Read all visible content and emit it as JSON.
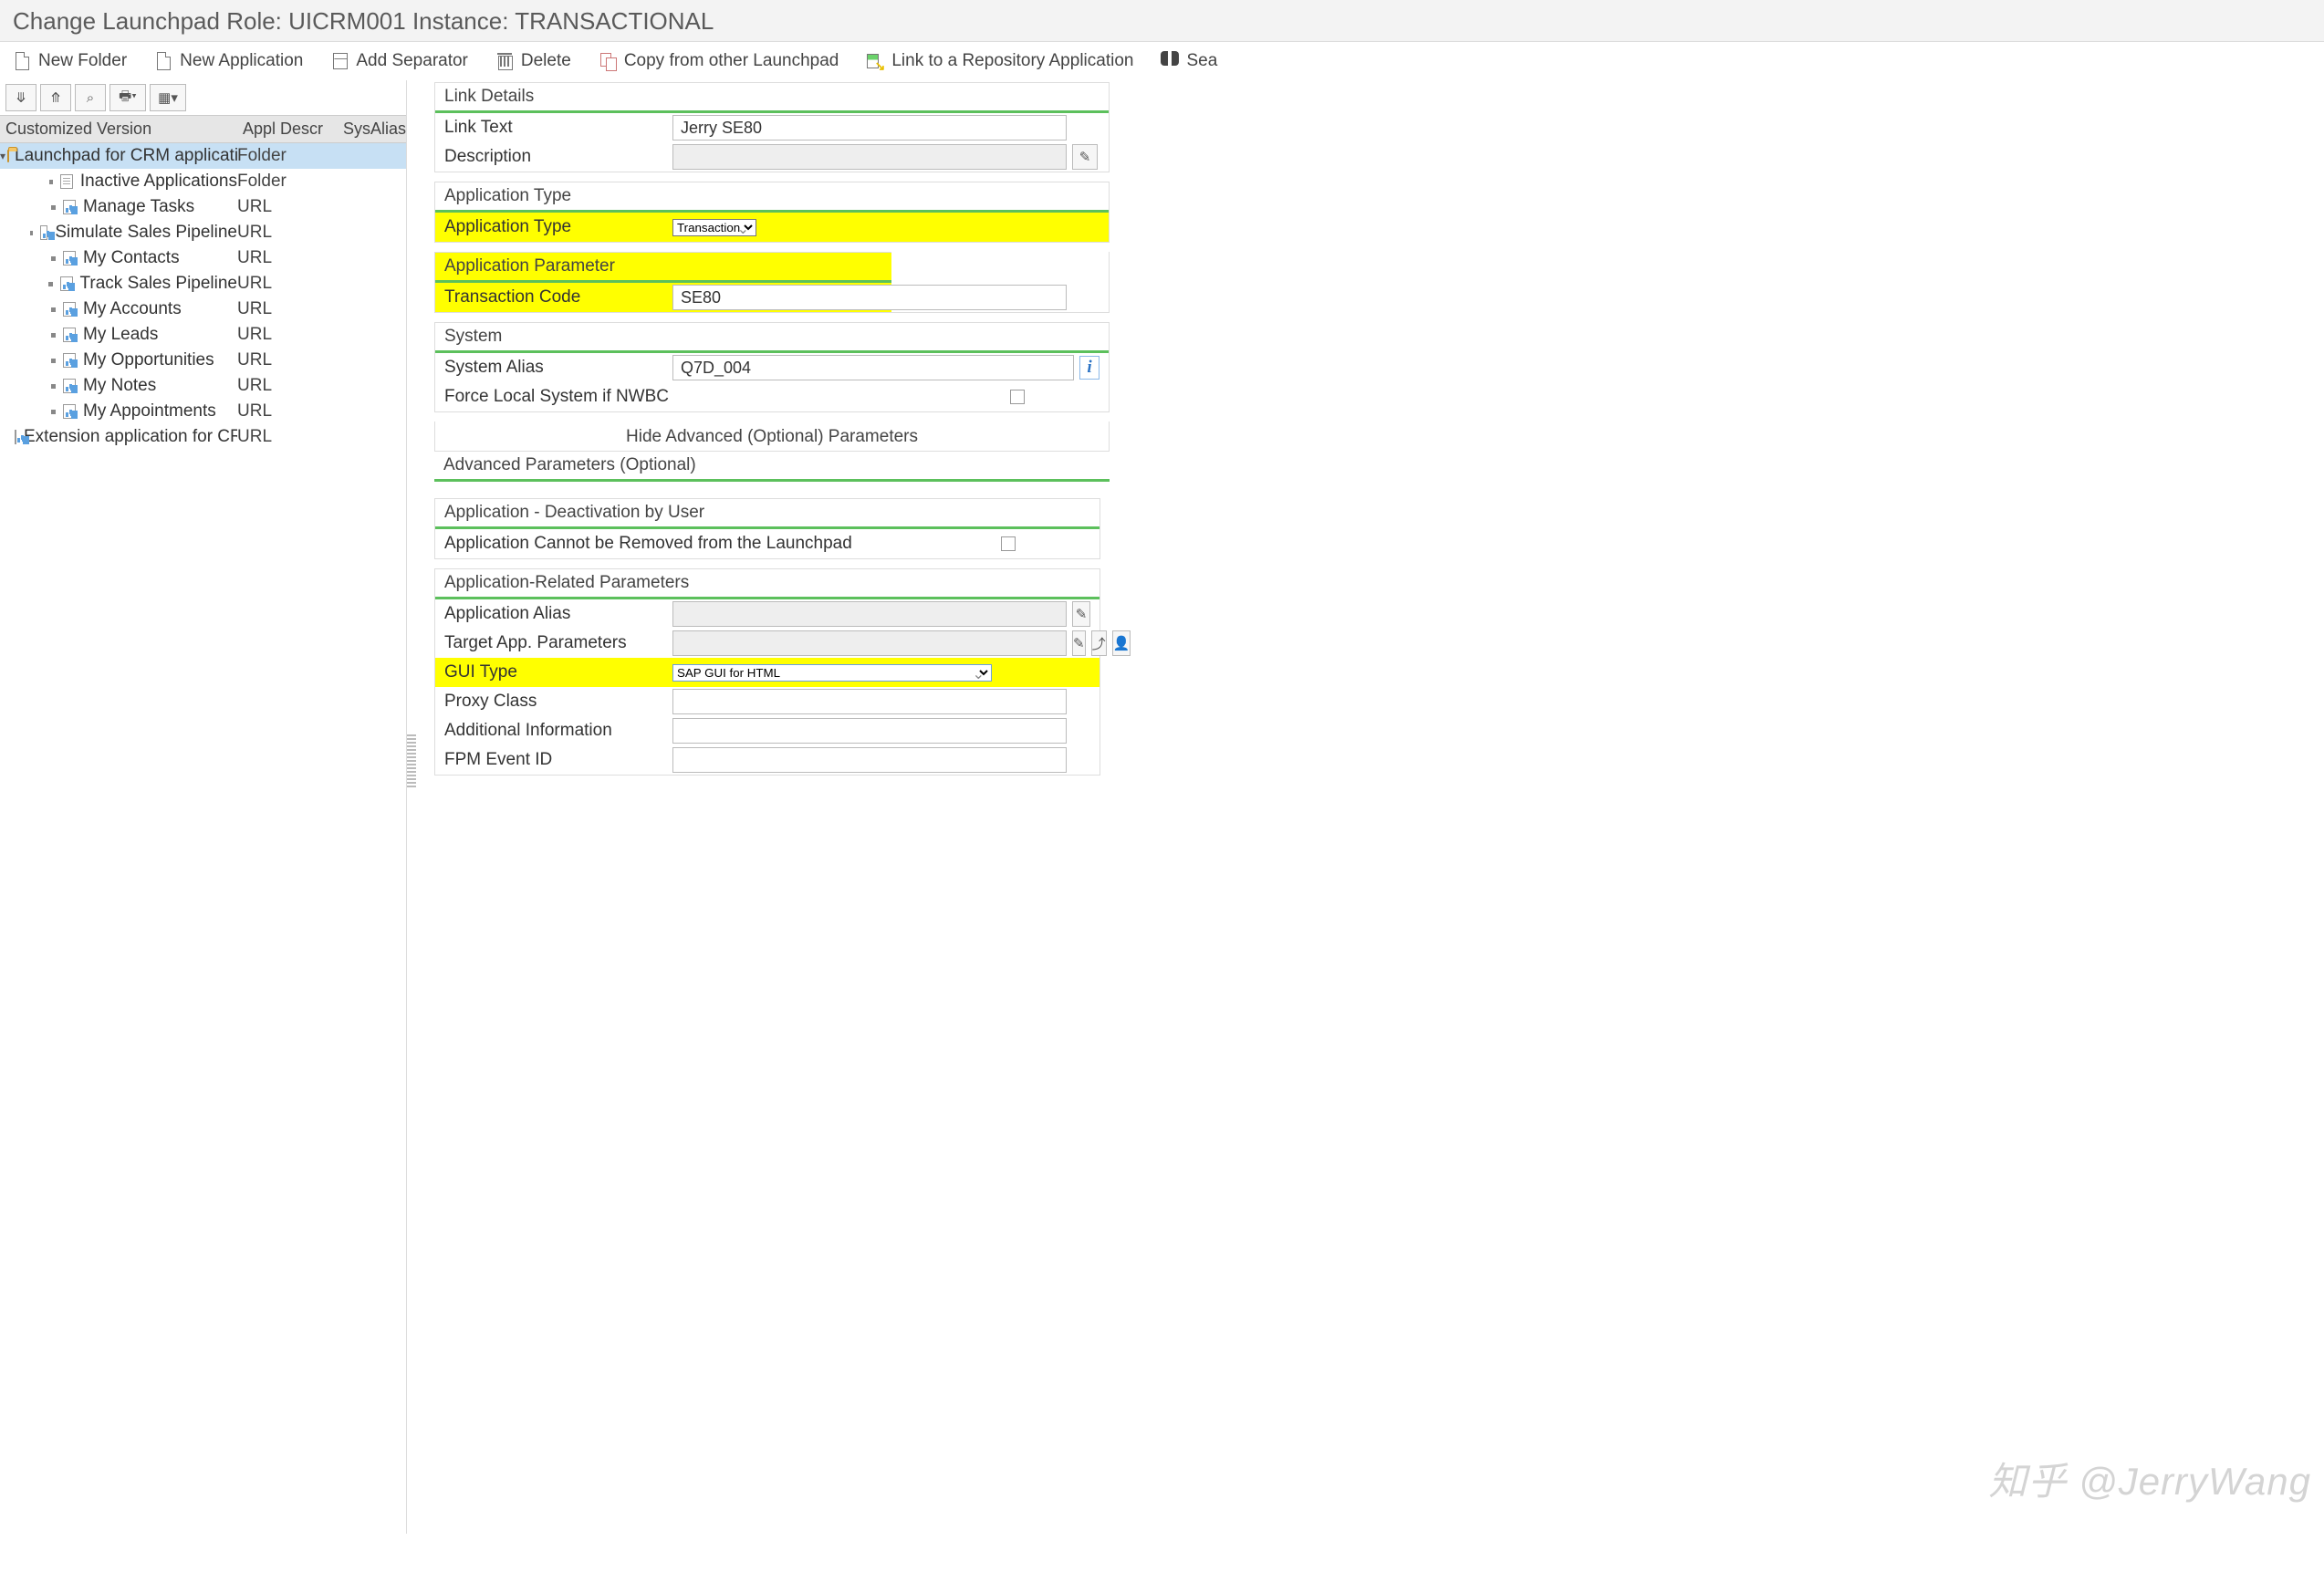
{
  "title": "Change Launchpad Role: UICRM001 Instance: TRANSACTIONAL",
  "toolbar": {
    "new_folder": "New Folder",
    "new_application": "New Application",
    "add_separator": "Add Separator",
    "delete": "Delete",
    "copy": "Copy from other Launchpad",
    "link_repo": "Link to a Repository Application",
    "search": "Sea"
  },
  "tree": {
    "headers": {
      "c1": "Customized Version",
      "c2": "Appl Descr",
      "c3": "SysAlias"
    },
    "root": {
      "label": "Launchpad for CRM application",
      "descr": "Folder"
    },
    "items": [
      {
        "label": "Inactive Applications",
        "descr": "Folder",
        "icon": "page"
      },
      {
        "label": "Manage Tasks",
        "descr": "URL",
        "icon": "chart"
      },
      {
        "label": "Simulate Sales Pipeline",
        "descr": "URL",
        "icon": "chart"
      },
      {
        "label": "My Contacts",
        "descr": "URL",
        "icon": "chart"
      },
      {
        "label": "Track Sales Pipeline",
        "descr": "URL",
        "icon": "chart"
      },
      {
        "label": "My Accounts",
        "descr": "URL",
        "icon": "chart"
      },
      {
        "label": "My Leads",
        "descr": "URL",
        "icon": "chart"
      },
      {
        "label": "My Opportunities",
        "descr": "URL",
        "icon": "chart"
      },
      {
        "label": "My Notes",
        "descr": "URL",
        "icon": "chart"
      },
      {
        "label": "My Appointments",
        "descr": "URL",
        "icon": "chart"
      },
      {
        "label": "Extension application for CR",
        "descr": "URL",
        "icon": "chart"
      }
    ]
  },
  "form": {
    "link_details": {
      "title": "Link Details",
      "link_text_label": "Link Text",
      "link_text_value": "Jerry SE80",
      "description_label": "Description",
      "description_value": ""
    },
    "app_type": {
      "title": "Application Type",
      "label": "Application Type",
      "value": "Transaction"
    },
    "app_param": {
      "title": "Application Parameter",
      "label": "Transaction Code",
      "value": "SE80"
    },
    "system": {
      "title": "System",
      "alias_label": "System Alias",
      "alias_value": "Q7D_004",
      "force_label": "Force Local System if NWBC"
    },
    "toggle": "Hide Advanced (Optional) Parameters",
    "adv_title": "Advanced Parameters (Optional)",
    "deact": {
      "title": "Application - Deactivation by User",
      "label": "Application Cannot be Removed from the Launchpad"
    },
    "related": {
      "title": "Application-Related Parameters",
      "alias_label": "Application Alias",
      "alias_value": "",
      "target_label": "Target App. Parameters",
      "target_value": "",
      "gui_label": "GUI Type",
      "gui_value": "SAP GUI for HTML",
      "proxy_label": "Proxy Class",
      "proxy_value": "",
      "addl_label": "Additional Information",
      "addl_value": "",
      "fpm_label": "FPM Event ID",
      "fpm_value": ""
    }
  },
  "watermark": "知乎 @JerryWang"
}
